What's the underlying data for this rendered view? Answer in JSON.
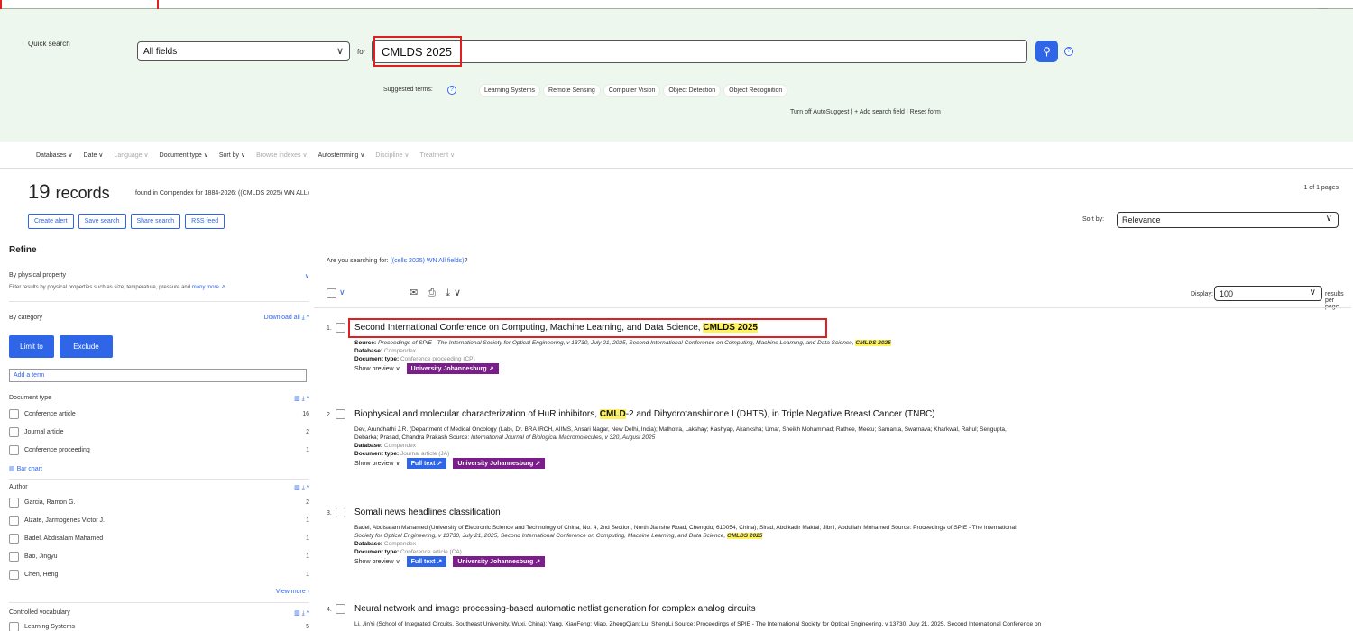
{
  "quick_search": {
    "label": "Quick search",
    "field_select": "All fields",
    "for_label": "for",
    "query": "CMLDS 2025",
    "help": "?",
    "suggested_label": "Suggested terms:",
    "suggested_terms": [
      "Learning Systems",
      "Remote Sensing",
      "Computer Vision",
      "Object Detection",
      "Object Recognition"
    ],
    "autosuggest_links": "Turn off AutoSuggest  |  + Add search field  |  Reset form"
  },
  "filterbar": {
    "items": [
      "Databases",
      "Date",
      "Language",
      "Document type",
      "Sort by",
      "Browse indexes",
      "Autostemming",
      "Discipline",
      "Treatment"
    ]
  },
  "summary": {
    "count": "19",
    "word": "records",
    "found_text": "found in Compendex for 1884-2026: ((CMLDS 2025) WN ALL)",
    "pages": "1 of 1 pages",
    "buttons": [
      "Create alert",
      "Save search",
      "Share search",
      "RSS feed"
    ],
    "sort_label": "Sort by:",
    "sort_value": "Relevance"
  },
  "refine": {
    "title": "Refine",
    "physical_title": "By physical property",
    "physical_sub": "Filter results by physical properties such as size, temperature, pressure and ",
    "physical_more": "many more ↗.",
    "category_title": "By category",
    "download_all": "Download all ⤓ ^",
    "limit_label": "Limit to",
    "exclude_label": "Exclude",
    "add_term": "Add a term",
    "doc_type_title": "Document type",
    "doc_types": [
      {
        "label": "Conference article",
        "count": "16"
      },
      {
        "label": "Journal article",
        "count": "2"
      },
      {
        "label": "Conference proceeding",
        "count": "1"
      }
    ],
    "bar_chart": "Bar chart",
    "author_title": "Author",
    "authors": [
      {
        "label": "Garcia, Ramon G.",
        "count": "2"
      },
      {
        "label": "Alzate, Jarmogenes Victor J.",
        "count": "1"
      },
      {
        "label": "Badel, Abdisalam Mahamed",
        "count": "1"
      },
      {
        "label": "Bao, Jingyu",
        "count": "1"
      },
      {
        "label": "Chen, Heng",
        "count": "1"
      }
    ],
    "view_more": "View more ›",
    "controlled_title": "Controlled vocabulary",
    "controlled": [
      {
        "label": "Learning Systems",
        "count": "5"
      }
    ]
  },
  "results": {
    "are_you_text": "Are you searching for: ",
    "are_you_link": "((cells 2025) WN All fields)",
    "are_you_end": "?",
    "display_label": "Display:",
    "display_value": "100",
    "rpp_label": "results per page",
    "records": [
      {
        "num": "1.",
        "title_pre": "Second International Conference on Computing, Machine Learning, and Data Science, ",
        "title_hl": "CMLDS 2025",
        "title_post": "",
        "authors": "",
        "source": "Proceedings of SPIE - The International Society for Optical Engineering, v 13730, July 21, 2025, Second International Conference on Computing, Machine Learning, and Data Science, ",
        "source_hl": "CMLDS 2025",
        "database": "Compendex",
        "doctype": "Conference proceeding (CP)",
        "full_text": "",
        "library": "University Johannesburg ↗"
      },
      {
        "num": "2.",
        "title_pre": "Biophysical and molecular characterization of HuR inhibitors, ",
        "title_hl": "CMLD",
        "title_post": "-2 and Dihydrotanshinone I (DHTS), in Triple Negative Breast Cancer (TNBC)",
        "authors_line1": "Dev, Arundhathi J.R. (Department of Medical Oncology (Lab), Dr. BRA IRCH, AIIMS, Ansari Nagar, New Delhi, India); Malhotra, Lakshay; Kashyap, Akanksha; Umar, Sheikh Mohammad; Rathee, Meetu; Samanta, Swarnava; Kharkwal, Rahul; Sengupta,",
        "authors_line2_pre": "Debarka; Prasad, Chandra Prakash Source: ",
        "source": "International Journal of Biological Macromolecules, v 320, August 2025",
        "database": "Compendex",
        "doctype": "Journal article (JA)",
        "full_text": "Full text ↗",
        "library": "University Johannesburg ↗"
      },
      {
        "num": "3.",
        "title_pre": "Somali news headlines classification",
        "title_hl": "",
        "title_post": "",
        "authors_line1": "Badel, Abdisalam Mahamed (University of Electronic Science and Technology of China, No. 4, 2nd Section, North Jianshe Road, Chengdu; 610054, China); Sirad, Abdikadir Maktal; Jibril, Abdullahi Mohamed Source: Proceedings of SPIE - The International",
        "source": "Society for Optical Engineering, v 13730, July 21, 2025, Second International Conference on Computing, Machine Learning, and Data Science, ",
        "source_hl": "CMLDS 2025",
        "database": "Compendex",
        "doctype": "Conference article (CA)",
        "full_text": "Full text ↗",
        "library": "University Johannesburg ↗"
      },
      {
        "num": "4.",
        "title_pre": "Neural network and image processing-based automatic netlist generation for complex analog circuits",
        "authors_line1": "Li, JinYi (School of Integrated Circuits, Southeast University, Wuxi, China); Yang, XiaoFeng; Miao, ZhengQian; Lu, ShengLi Source: Proceedings of SPIE - The International Society for Optical Engineering, v 13730, July 21, 2025, Second International Conference on"
      }
    ],
    "source_label": "Source:",
    "database_label": "Database:",
    "doctype_label": "Document type:",
    "show_preview": "Show preview"
  }
}
